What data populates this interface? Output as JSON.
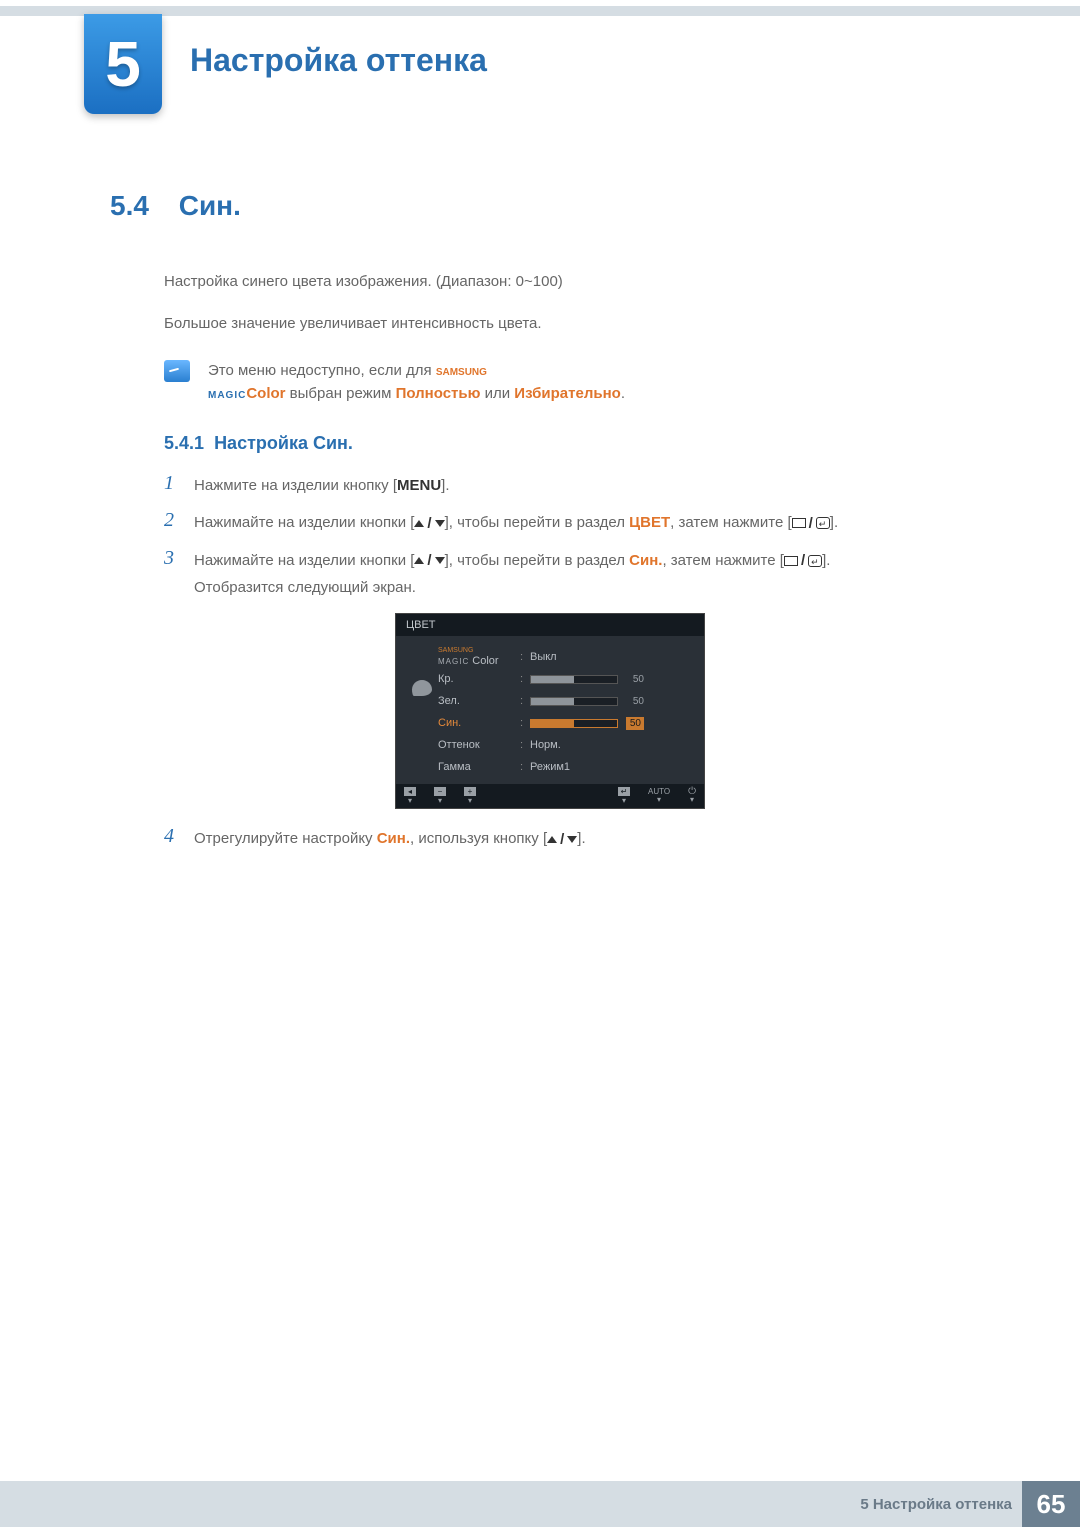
{
  "chapter": {
    "number": "5",
    "title": "Настройка оттенка"
  },
  "section": {
    "number": "5.4",
    "title": "Син."
  },
  "intro": {
    "p1": "Настройка синего цвета изображения. (Диапазон: 0~100)",
    "p2": "Большое значение увеличивает интенсивность цвета."
  },
  "note": {
    "pre": "Это меню недоступно, если для ",
    "brand_top": "SAMSUNG",
    "brand_bottom": "MAGIC",
    "brand_suffix": "Color",
    "mid": " выбран режим ",
    "mode1": "Полностью",
    "or": " или ",
    "mode2": "Избирательно",
    "post": "."
  },
  "subsection": {
    "number": "5.4.1",
    "title": "Настройка Син."
  },
  "steps": {
    "s1": {
      "num": "1",
      "pre": "Нажмите на изделии кнопку [",
      "btn": "MENU",
      "post": "]."
    },
    "s2": {
      "num": "2",
      "pre": "Нажимайте на изделии кнопки [",
      "mid": "], чтобы перейти в раздел ",
      "target": "ЦВЕТ",
      "after": ", затем нажмите [",
      "post": "]."
    },
    "s3": {
      "num": "3",
      "pre": "Нажимайте на изделии кнопки [",
      "mid": "], чтобы перейти в раздел ",
      "target": "Син.",
      "after": ", затем нажмите [",
      "post": "].",
      "extra": "Отобразится следующий экран."
    },
    "s4": {
      "num": "4",
      "pre": "Отрегулируйте настройку ",
      "target": "Син.",
      "mid": ", используя кнопку [",
      "post": "]."
    }
  },
  "osd": {
    "title": "ЦВЕТ",
    "magic_top": "SAMSUNG",
    "magic_bottom": "MAGIC",
    "magic_suffix": "Color",
    "rows": {
      "magic_val": "Выкл",
      "kr_label": "Кр.",
      "kr_val": "50",
      "zel_label": "Зел.",
      "zel_val": "50",
      "sin_label": "Син.",
      "sin_val": "50",
      "tone_label": "Оттенок",
      "tone_val": "Норм.",
      "gamma_label": "Гамма",
      "gamma_val": "Режим1"
    },
    "footer": {
      "auto": "AUTO"
    }
  },
  "footer": {
    "label": "5 Настройка оттенка",
    "page": "65"
  }
}
